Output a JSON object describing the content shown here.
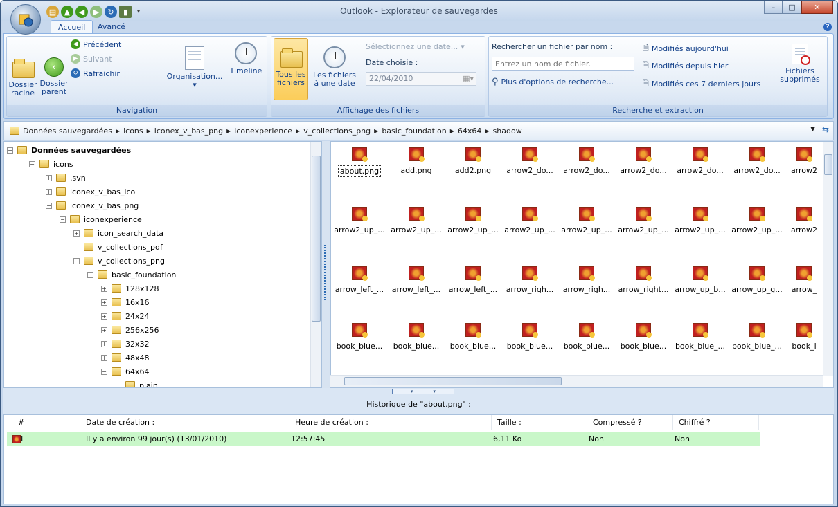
{
  "window": {
    "title": "Outlook - Explorateur de sauvegardes"
  },
  "tabs": [
    "Accueil",
    "Avancé"
  ],
  "ribbon": {
    "navigation": {
      "title": "Navigation",
      "dossier_racine": "Dossier racine",
      "dossier_parent": "Dossier parent",
      "precedent": "Précédent",
      "suivant": "Suivant",
      "rafraichir": "Rafraichir",
      "organisation": "Organisation...",
      "timeline": "Timeline"
    },
    "affichage": {
      "title": "Affichage des fichiers",
      "tous_les_fichiers": "Tous les fichiers",
      "fichiers_date": "Les fichiers à une date",
      "selectionnez": "Sélectionnez une date...",
      "date_choisie_label": "Date choisie :",
      "date_value": "22/04/2010"
    },
    "recherche": {
      "title": "Recherche et extraction",
      "rechercher_label": "Rechercher un fichier par nom :",
      "placeholder": "Entrez un nom de fichier.",
      "plus_options": "Plus d'options de recherche...",
      "modifies_aujourdhui": "Modifiés aujourd'hui",
      "modifies_hier": "Modifiés depuis hier",
      "modifies_7": "Modifiés ces 7 derniers jours",
      "fichiers_supprimes": "Fichiers supprimés"
    }
  },
  "breadcrumb": [
    "Données sauvegardées",
    "icons",
    "iconex_v_bas_png",
    "iconexperience",
    "v_collections_png",
    "basic_foundation",
    "64x64",
    "shadow"
  ],
  "tree": [
    {
      "label": "Données sauvegardées",
      "toggle": "−",
      "bold": true
    },
    {
      "label": "icons",
      "toggle": "−"
    },
    {
      "label": ".svn",
      "toggle": "+"
    },
    {
      "label": "iconex_v_bas_ico",
      "toggle": "+"
    },
    {
      "label": "iconex_v_bas_png",
      "toggle": "−"
    },
    {
      "label": "iconexperience",
      "toggle": "−"
    },
    {
      "label": "icon_search_data",
      "toggle": "+"
    },
    {
      "label": "v_collections_pdf",
      "toggle": ""
    },
    {
      "label": "v_collections_png",
      "toggle": "−"
    },
    {
      "label": "basic_foundation",
      "toggle": "−"
    },
    {
      "label": "128x128",
      "toggle": "+"
    },
    {
      "label": "16x16",
      "toggle": "+"
    },
    {
      "label": "24x24",
      "toggle": "+"
    },
    {
      "label": "256x256",
      "toggle": "+"
    },
    {
      "label": "32x32",
      "toggle": "+"
    },
    {
      "label": "48x48",
      "toggle": "+"
    },
    {
      "label": "64x64",
      "toggle": "−"
    },
    {
      "label": "plain",
      "toggle": ""
    }
  ],
  "files": [
    [
      "about.png",
      "add.png",
      "add2.png",
      "arrow2_do...",
      "arrow2_do...",
      "arrow2_do...",
      "arrow2_do...",
      "arrow2_do...",
      "arrow2"
    ],
    [
      "arrow2_up_...",
      "arrow2_up_...",
      "arrow2_up_...",
      "arrow2_up_...",
      "arrow2_up_...",
      "arrow2_up_...",
      "arrow2_up_...",
      "arrow2_up_...",
      "arrow2"
    ],
    [
      "arrow_left_...",
      "arrow_left_...",
      "arrow_left_...",
      "arrow_righ...",
      "arrow_righ...",
      "arrow_right...",
      "arrow_up_b...",
      "arrow_up_g...",
      "arrow_"
    ],
    [
      "book_blue...",
      "book_blue...",
      "book_blue...",
      "book_blue...",
      "book_blue...",
      "book_blue...",
      "book_blue_...",
      "book_blue_...",
      "book_l"
    ]
  ],
  "history": {
    "title": "Historique de \"about.png\" :",
    "columns": [
      "#",
      "Date de création :",
      "Heure de création :",
      "Taille :",
      "Compressé ?",
      "Chiffré ?"
    ],
    "rows": [
      [
        "1",
        "Il y a environ 99 jour(s) (13/01/2010)",
        "12:57:45",
        "6,11 Ko",
        "Non",
        "Non"
      ]
    ]
  },
  "colors": {
    "selection_row": "#c9f7c9",
    "ribbon_selected": "#fbcd5a"
  }
}
